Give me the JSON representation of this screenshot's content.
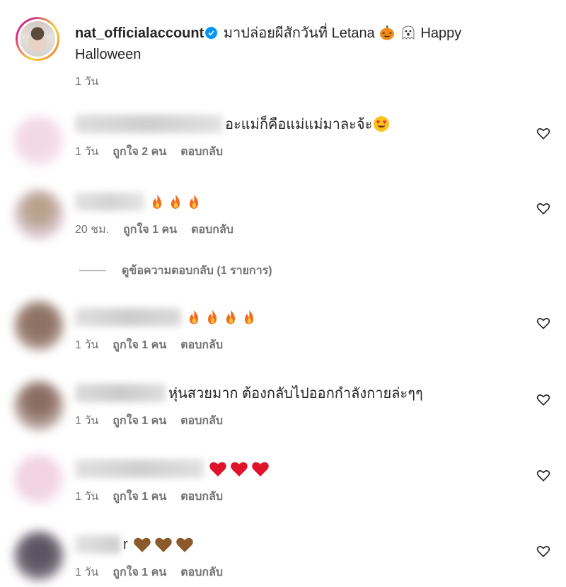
{
  "caption": {
    "username": "nat_officialaccount",
    "text_before": "มาปล่อยผีสักวันที่ Letana",
    "text_after": "Happy",
    "text_line2": "Halloween",
    "time": "1 วัน",
    "emojis": [
      "jack-o-lantern",
      "ghost"
    ]
  },
  "view_replies_label": "ดูข้อความตอบกลับ (1 รายการ)",
  "comments": [
    {
      "text": "อะแม่ก็คือแม่แม่มาละจ้ะ",
      "emojis": [
        "heart-eyes-face"
      ],
      "time": "1 วัน",
      "likes": "ถูกใจ 2 คน",
      "reply": "ตอบกลับ"
    },
    {
      "text": "",
      "emojis": [
        "fire",
        "fire",
        "fire"
      ],
      "time": "20 ชม.",
      "likes": "ถูกใจ 1 คน",
      "reply": "ตอบกลับ"
    },
    {
      "text": "",
      "emojis": [
        "fire",
        "fire",
        "fire",
        "fire"
      ],
      "time": "1 วัน",
      "likes": "ถูกใจ 1 คน",
      "reply": "ตอบกลับ"
    },
    {
      "text": "หุ่นสวยมาก ต้องกลับไปออกกำลังกายล่ะๆๆ",
      "emojis": [],
      "time": "1 วัน",
      "likes": "ถูกใจ 1 คน",
      "reply": "ตอบกลับ"
    },
    {
      "text": "",
      "emojis": [
        "red-heart",
        "red-heart",
        "red-heart"
      ],
      "time": "1 วัน",
      "likes": "ถูกใจ 1 คน",
      "reply": "ตอบกลับ"
    },
    {
      "text": "r",
      "emojis": [
        "brown-heart",
        "brown-heart",
        "brown-heart"
      ],
      "time": "1 วัน",
      "likes": "ถูกใจ 1 คน",
      "reply": "ตอบกลับ"
    }
  ],
  "colors": {
    "verified": "#0095f6",
    "meta": "#737373",
    "text": "#262626"
  }
}
